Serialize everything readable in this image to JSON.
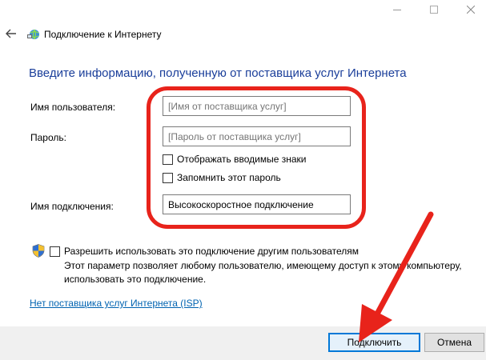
{
  "window": {
    "title": "Подключение к Интернету"
  },
  "form": {
    "heading": "Введите информацию, полученную от поставщика услуг Интернета",
    "username_label": "Имя пользователя:",
    "username_placeholder": "[Имя от поставщика услуг]",
    "password_label": "Пароль:",
    "password_placeholder": "[Пароль от поставщика услуг]",
    "show_chars_label": "Отображать вводимые знаки",
    "remember_password_label": "Запомнить этот пароль",
    "connection_name_label": "Имя подключения:",
    "connection_name_value": "Высокоскоростное подключение"
  },
  "sharing": {
    "checkbox_label": "Разрешить использовать это подключение другим пользователям",
    "description": "Этот параметр позволяет любому пользователю, имеющему доступ к этому компьютеру, использовать это подключение."
  },
  "links": {
    "no_isp": "Нет поставщика услуг Интернета (ISP)"
  },
  "buttons": {
    "connect": "Подключить",
    "cancel": "Отмена"
  },
  "colors": {
    "heading": "#1a3e9a",
    "link": "#0063b1",
    "highlight": "#e8231b",
    "accent": "#0078d7"
  },
  "icons": {
    "back": "back-arrow-icon",
    "app": "network-globe-icon",
    "shield": "uac-shield-icon"
  }
}
